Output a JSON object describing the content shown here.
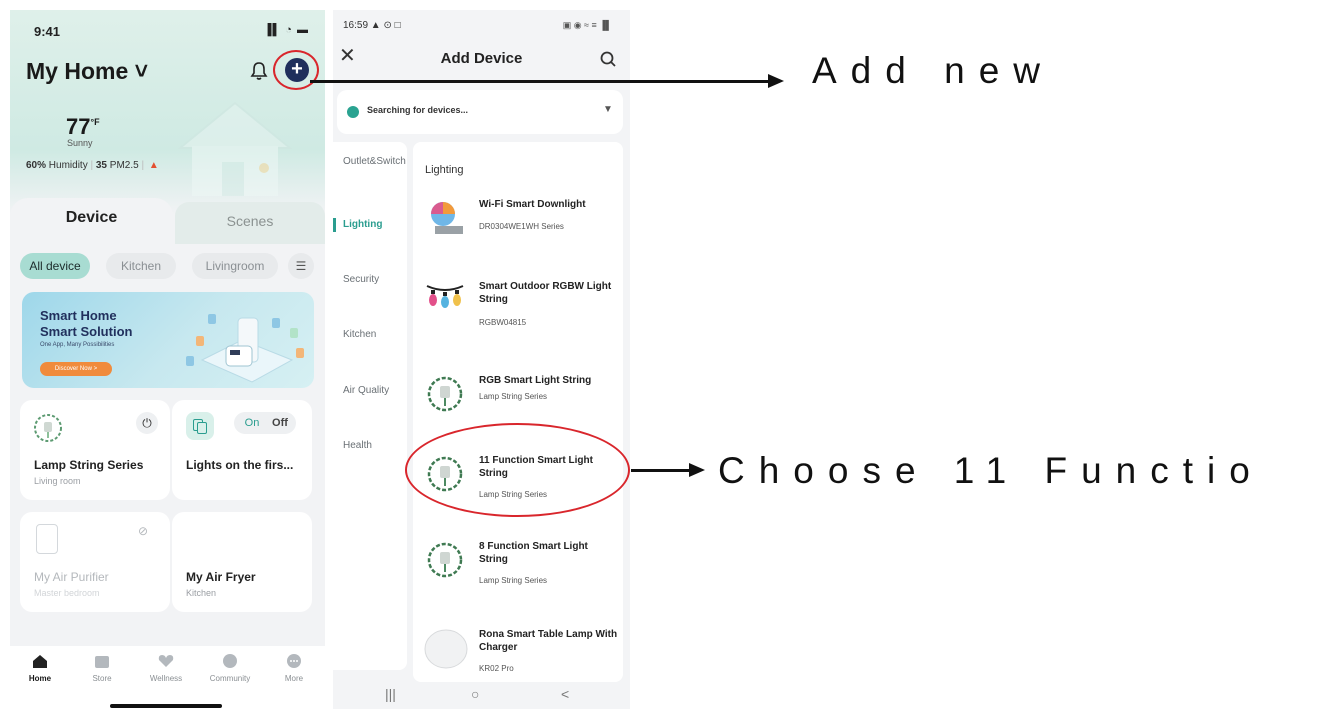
{
  "left_app": {
    "status_time": "9:41",
    "status_icons": "▐▌ ◔ ▬",
    "home_title": "My Home ˅",
    "weather": {
      "temp": "77",
      "unit": "°F",
      "condition": "Sunny"
    },
    "env": {
      "humidity": "60%",
      "humidity_label": "Humidity",
      "pm_value": "35",
      "pm_label": "PM2.5"
    },
    "tabs": {
      "device": "Device",
      "scenes": "Scenes"
    },
    "chips": [
      "All device",
      "Kitchen",
      "Livingroom"
    ],
    "banner": {
      "line1": "Smart Home",
      "line2": "Smart Solution",
      "tagline": "One App, Many Possibilities",
      "button": "Discover Now >"
    },
    "devices": [
      {
        "name": "Lamp String Series",
        "room": "Living room"
      },
      {
        "name": "Lights on the firs...",
        "room": "",
        "on": "On",
        "off": "Off"
      },
      {
        "name": "My Air Purifier",
        "room": "Master bedroom"
      },
      {
        "name": "My Air Fryer",
        "room": "Kitchen"
      }
    ],
    "nav": [
      "Home",
      "Store",
      "Wellness",
      "Community",
      "More"
    ]
  },
  "right_app": {
    "status_time": "16:59 ▲ ⊙ □",
    "status_icons": "▣ ◉ ≈ ≡ ▐▌",
    "title": "Add Device",
    "searching": "Searching for devices...",
    "categories": [
      "Outlet&Switch",
      "Lighting",
      "Security",
      "Kitchen",
      "Air Quality",
      "Health"
    ],
    "list_heading": "Lighting",
    "devices": [
      {
        "name": "Wi-Fi Smart Downlight",
        "sub": "DR0304WE1WH Series"
      },
      {
        "name": "Smart Outdoor RGBW Light String",
        "sub": "RGBW04815"
      },
      {
        "name": "RGB Smart Light String",
        "sub": "Lamp String Series"
      },
      {
        "name": "11 Function Smart Light String",
        "sub": "Lamp String Series"
      },
      {
        "name": "8 Function Smart Light String",
        "sub": "Lamp String Series"
      },
      {
        "name": "Rona Smart Table Lamp With Charger",
        "sub": "KR02 Pro"
      }
    ],
    "sysnav": [
      "|||",
      "○",
      "<"
    ]
  },
  "annotations": {
    "add_new": "Add new",
    "choose": "Choose 11 Functio"
  },
  "colors": {
    "accent": "#2a9d8f",
    "highlight": "#d9262c",
    "add_button": "#1f2f5c"
  }
}
